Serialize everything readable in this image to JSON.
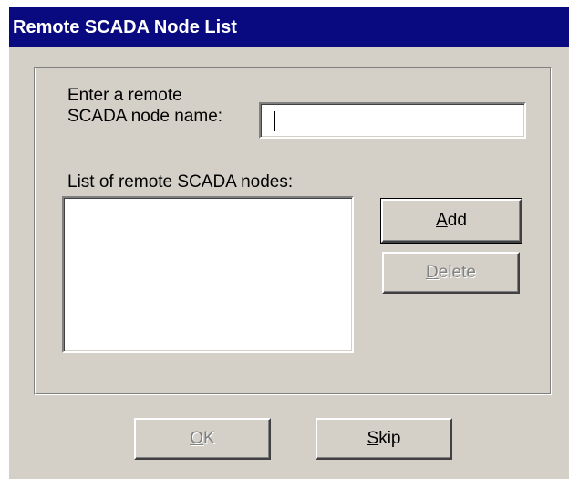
{
  "window": {
    "title": "Remote SCADA Node List"
  },
  "node_name": {
    "label_line1": "Enter a remote",
    "label_line2": "SCADA node name:",
    "value": ""
  },
  "node_list": {
    "label": "List of remote SCADA nodes:",
    "items": []
  },
  "buttons": {
    "add": {
      "mnemonic": "A",
      "rest": "dd",
      "enabled": true,
      "default": true
    },
    "delete": {
      "mnemonic": "D",
      "rest": "elete",
      "enabled": false
    },
    "ok": {
      "mnemonic": "O",
      "rest": "K",
      "enabled": false
    },
    "skip": {
      "mnemonic": "S",
      "rest": "kip",
      "enabled": true
    }
  },
  "colors": {
    "titlebar": "#0a0a80",
    "dialog_face": "#d4d0c8",
    "disabled_text": "#808080"
  }
}
